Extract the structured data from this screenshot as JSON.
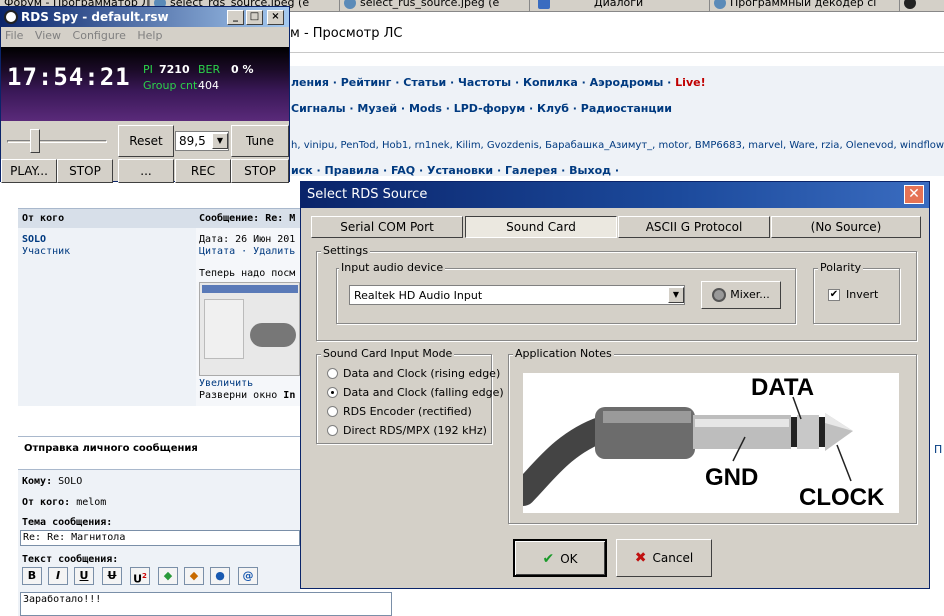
{
  "browser": {
    "tabs": [
      {
        "label": "Форум - Программатор ЛС"
      },
      {
        "label": "select_rds_source.jpeg (e"
      },
      {
        "label": "select_rus_source.jpeg (e"
      },
      {
        "label": "Диалоги"
      },
      {
        "label": "Программный декодер сі"
      }
    ],
    "page_title": "м - Просмотр ЛС"
  },
  "forum": {
    "nav1": [
      "ления",
      "Рейтинг",
      "Статьи",
      "Частоты",
      "Копилка",
      "Аэродромы",
      "Live!"
    ],
    "nav2": [
      "Сигналы",
      "Музей",
      "Mods",
      "LPD-форум",
      "Клуб",
      "Радиостанции"
    ],
    "nicks": "h, vinipu, PenTod, Hob1, rn1nek, Kilim, Gvozdenis, Барабашка_Азимут_, motor, BMP6683, marvel, Ware, rzia, Olenevod, windflower",
    "nav3": [
      "иск",
      "Правила",
      "FAQ",
      "Установки",
      "Галерея",
      "Выход"
    ],
    "header_from": "От кого",
    "header_msg": "Сообщение: Re: M",
    "author": "SOLO",
    "author_role": "Участник",
    "date": "Дата: 26 Июн 201",
    "actions": "Цитата · Удалить",
    "body_line1": "Теперь надо посм",
    "enlarge": "Увеличить",
    "body_line2_a": "Разверни окно ",
    "body_line2_b": "In",
    "send_title": "Отправка личного сообщения",
    "to_label": "Кому:",
    "to_value": "SOLO",
    "from_label": "От кого:",
    "from_value": "melom",
    "subject_label": "Тема сообщения:",
    "subject_value": "Re: Re: Магнитола",
    "text_label": "Текст сообщения:",
    "text_value": "Заработало!!!",
    "format_buttons": [
      "B",
      "I",
      "U",
      "U",
      "U",
      "",
      "",
      "",
      "@"
    ],
    "format_sup": "2",
    "right_cut": "П"
  },
  "rds_spy": {
    "title": "RDS Spy - default.rsw",
    "menu": [
      "File",
      "View",
      "Configure",
      "Help"
    ],
    "clock": "17:54:21",
    "pi_label": "PI",
    "pi_value": "7210",
    "ber_label": "BER",
    "ber_value": "0 %",
    "group_label": "Group cnt",
    "group_value": "404",
    "reset": "Reset",
    "freq": "89,5",
    "tune": "Tune",
    "play": "PLAY...",
    "stop1": "STOP",
    "dots": "...",
    "rec": "REC",
    "stop2": "STOP",
    "slider_level": 0.25
  },
  "dialog": {
    "title": "Select RDS Source",
    "tabs": [
      "Serial COM Port",
      "Sound Card",
      "ASCII G Protocol",
      "(No Source)"
    ],
    "settings": "Settings",
    "input_device_label": "Input audio device",
    "input_device_value": "Realtek HD Audio Input",
    "mixer": "Mixer...",
    "polarity": "Polarity",
    "invert": "Invert",
    "invert_checked": true,
    "mode_title": "Sound Card Input Mode",
    "modes": [
      {
        "label": "Data and Clock (rising edge)",
        "selected": false
      },
      {
        "label": "Data and Clock (falling edge)",
        "selected": true
      },
      {
        "label": "RDS Encoder (rectified)",
        "selected": false
      },
      {
        "label": "Direct RDS/MPX (192 kHz)",
        "selected": false
      }
    ],
    "notes_title": "Application Notes",
    "diagram": {
      "data": "DATA",
      "gnd": "GND",
      "clock": "CLOCK"
    },
    "ok": "OK",
    "cancel": "Cancel"
  }
}
